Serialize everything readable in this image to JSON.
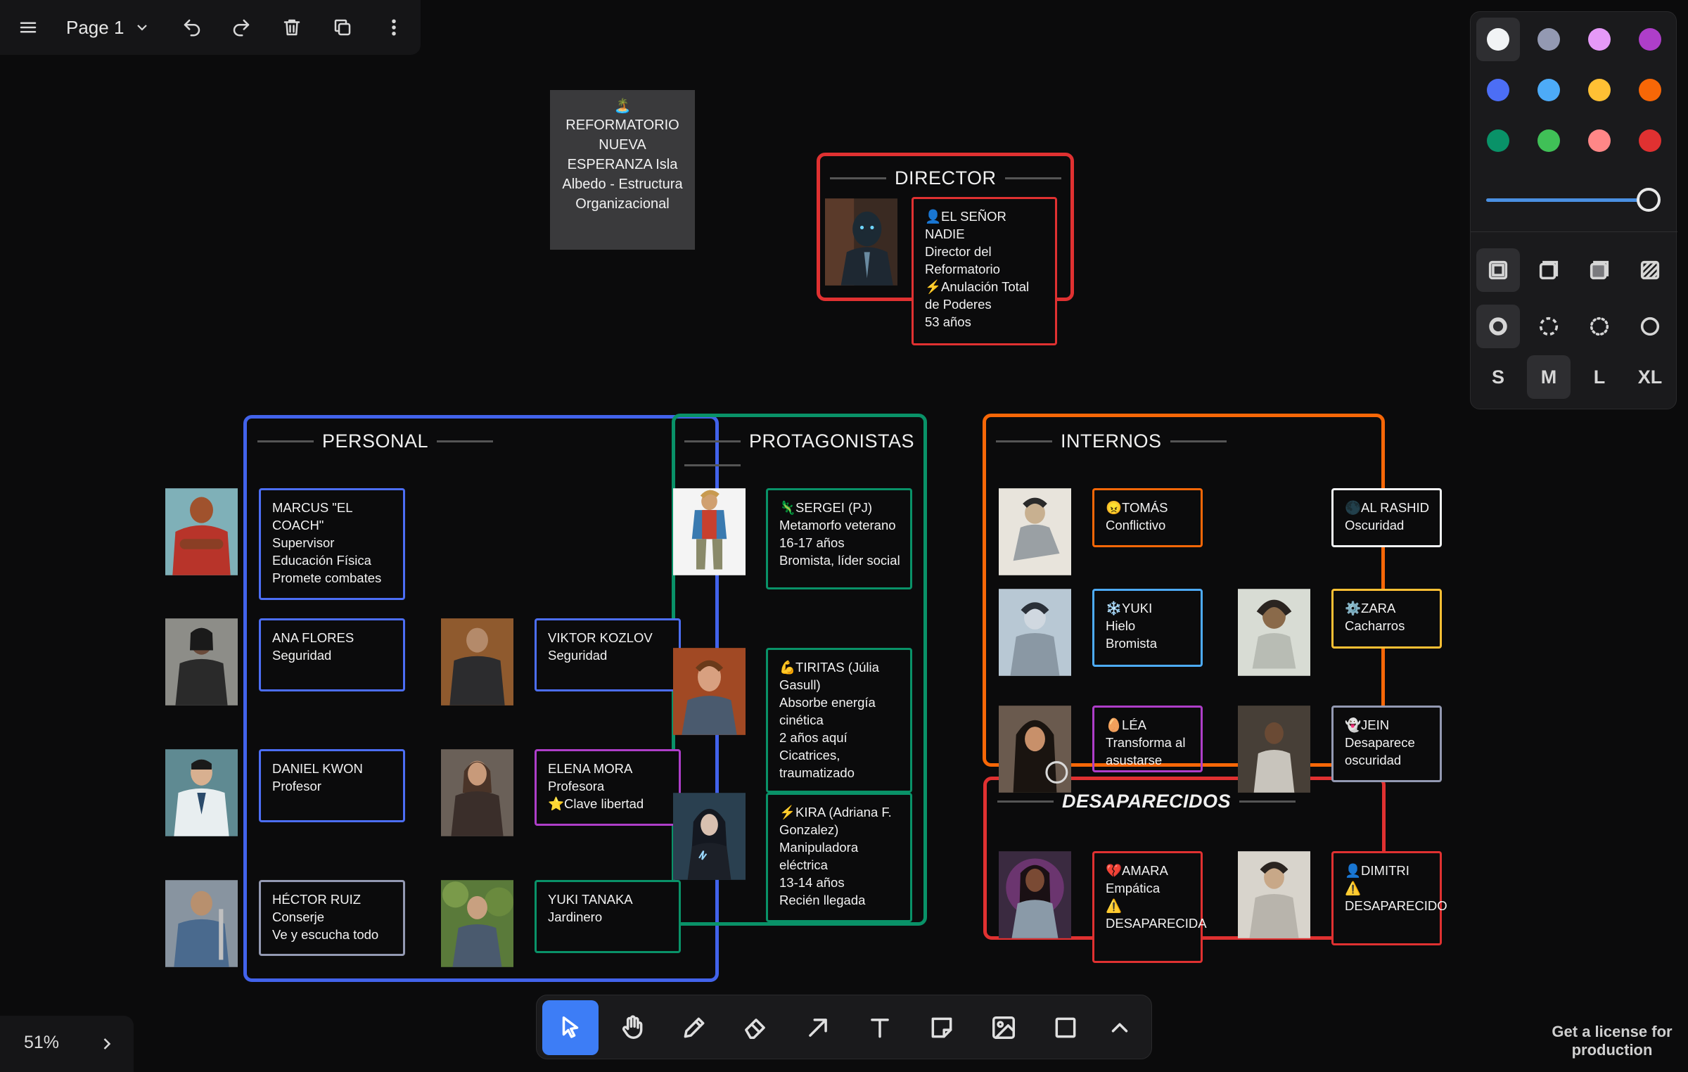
{
  "menu": {
    "page_name": "Page 1"
  },
  "title_note": {
    "icon": "🏝️",
    "text": "REFORMATORIO NUEVA ESPERANZA Isla Albedo - Estructura Organizacional"
  },
  "frames": {
    "director": {
      "title": "DIRECTOR",
      "color": "#e03131"
    },
    "personal": {
      "title": "PERSONAL",
      "color": "#4263eb"
    },
    "protagonistas": {
      "title": "PROTAGONISTAS",
      "color": "#099268"
    },
    "internos": {
      "title": "INTERNOS",
      "color": "#f76707"
    },
    "desaparecidos": {
      "title": "DESAPARECIDOS",
      "color": "#e03131"
    }
  },
  "cards": {
    "director": "👤EL SEÑOR NADIE\nDirector del Reformatorio\n⚡Anulación Total de Poderes\n53 años",
    "marcus": "MARCUS \"EL COACH\"\nSupervisor Educación Física\nPromete combates",
    "ana": "ANA FLORES\nSeguridad",
    "viktor": "VIKTOR KOZLOV\nSeguridad",
    "daniel": "DANIEL KWON\nProfesor",
    "elena": "ELENA MORA\nProfesora\n⭐Clave libertad",
    "hector": "HÉCTOR RUIZ\nConserje\nVe y escucha todo",
    "yuki_tanaka": "YUKI TANAKA\nJardinero",
    "sergei": "🦎SERGEI (PJ)\nMetamorfo veterano\n16-17 años\nBromista, líder social",
    "tiritas": "💪TIRITAS (Júlia Gasull)\nAbsorbe energía cinética\n2 años aquí\nCicatrices, traumatizado",
    "kira": "⚡KIRA (Adriana F. Gonzalez)\nManipuladora eléctrica\n13-14 años\nRecién llegada",
    "tomas": "😠TOMÁS\nConflictivo",
    "al_rashid": "🌑AL RASHID\nOscuridad",
    "yuki": "❄️YUKI\nHielo\nBromista",
    "zara": "⚙️ZARA\nCacharros",
    "lea": "🥚LÉA\nTransforma al asustarse",
    "jein": "👻JEIN\nDesaparece oscuridad",
    "amara": "💔AMARA\nEmpática\n⚠️ DESAPARECIDA",
    "dimitri": "👤DIMITRI\n⚠️ DESAPARECIDO"
  },
  "style_panel": {
    "colors": [
      "#f1f3f5",
      "#9399b2",
      "#e599f7",
      "#ae3ec9",
      "#4c6ef5",
      "#4dabf7",
      "#ffc034",
      "#f76707",
      "#099268",
      "#40c057",
      "#ff8787",
      "#e03131"
    ],
    "opacity": 1,
    "sizes": [
      "S",
      "M",
      "L",
      "XL"
    ],
    "selected_size": "M"
  },
  "toolbar": {
    "tools": [
      "select-tool",
      "hand-tool",
      "draw-tool",
      "eraser-tool",
      "arrow-tool",
      "text-tool",
      "note-tool",
      "image-tool",
      "rectangle-tool",
      "more-tools"
    ],
    "selected": "select-tool"
  },
  "zoom": {
    "level": "51%"
  },
  "license": {
    "text": "Get a license for production"
  }
}
